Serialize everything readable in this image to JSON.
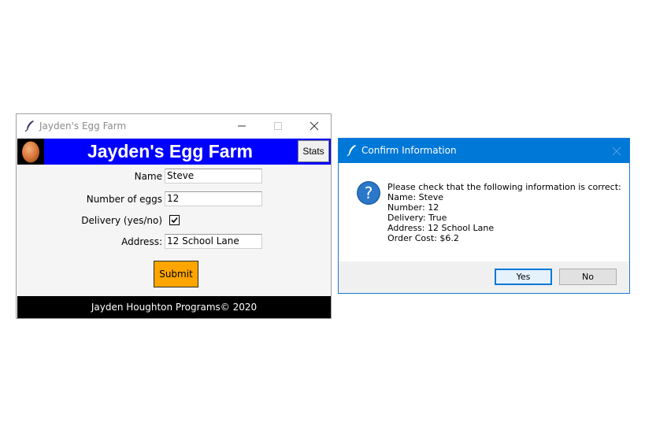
{
  "main_window": {
    "title": "Jayden's Egg Farm",
    "header_title": "Jayden's Egg Farm",
    "stats_button": "Stats",
    "fields": {
      "name_label": "Name",
      "name_value": "Steve",
      "eggs_label": "Number of eggs",
      "eggs_value": "12",
      "delivery_label": "Delivery (yes/no)",
      "delivery_checked": true,
      "address_label": "Address:",
      "address_value": "12 School Lane"
    },
    "submit_button": "Submit",
    "footer_text": "Jayden Houghton Programs© 2020",
    "colors": {
      "header": "#0000ff",
      "submit": "#ffa500",
      "footer": "#000000"
    }
  },
  "dialog": {
    "title": "Confirm Information",
    "message_lines": [
      "Please check that the following information is correct:",
      "Name: Steve",
      "Number: 12",
      "Delivery: True",
      "Address: 12 School Lane",
      "Order Cost: $6.2"
    ],
    "yes_button": "Yes",
    "no_button": "No",
    "icon": "question-icon",
    "colors": {
      "titlebar": "#0078d7"
    }
  }
}
